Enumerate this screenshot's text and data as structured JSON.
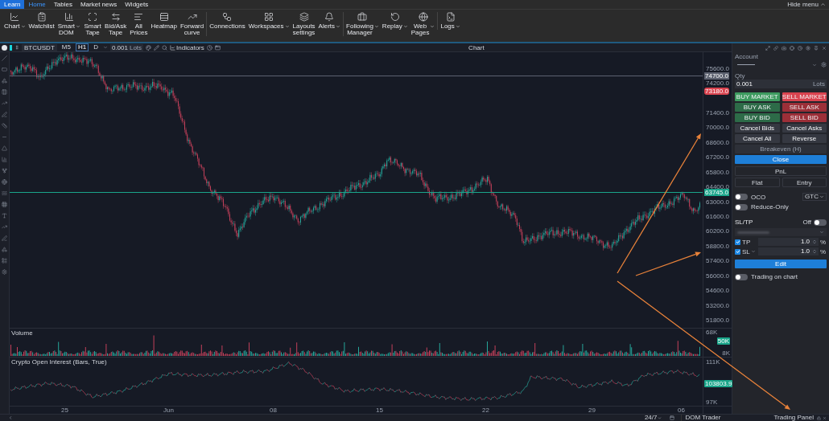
{
  "menu_bar": {
    "learn_button": "Learn",
    "tabs": [
      {
        "label": "Home",
        "selected": true
      },
      {
        "label": "Tables",
        "selected": false
      },
      {
        "label": "Market news",
        "selected": false
      },
      {
        "label": "Widgets",
        "selected": false
      }
    ],
    "hide_menu": "Hide menu"
  },
  "ribbon": [
    [
      {
        "label": "Chart",
        "has_menu": true
      },
      {
        "label": "Watchlist",
        "has_menu": false
      },
      {
        "label": "Smart DOM",
        "has_menu": true
      },
      {
        "label": "Smart Tape",
        "has_menu": false
      },
      {
        "label": "Bid/Ask Tape",
        "has_menu": false
      },
      {
        "label": "All Prices",
        "has_menu": false
      },
      {
        "label": "Heatmap",
        "has_menu": false
      },
      {
        "label": "Forward curve",
        "has_menu": false
      }
    ],
    [
      {
        "label": "Connections",
        "has_menu": false
      },
      {
        "label": "Workspaces",
        "has_menu": true
      },
      {
        "label": "Layouts settings",
        "has_menu": false
      },
      {
        "label": "Alerts",
        "has_menu": true
      }
    ],
    [
      {
        "label": "Following Manager",
        "has_menu": true
      },
      {
        "label": "Replay",
        "has_menu": true
      },
      {
        "label": "Web Pages",
        "has_menu": true
      }
    ],
    [
      {
        "label": "Logs",
        "has_menu": true
      }
    ]
  ],
  "chart": {
    "title": "Chart",
    "symbol": "BTCUSDT",
    "timeframes": [
      {
        "label": "M5",
        "selected": false
      },
      {
        "label": "H1",
        "selected": true
      },
      {
        "label": "D",
        "selected": false
      }
    ],
    "quantity": "0.001",
    "quantity_unit": "Lots",
    "indicators": "Indicators",
    "price_ticks": [
      "75600.0",
      "74200.0",
      "71400.0",
      "70000.0",
      "68600.0",
      "67200.0",
      "65800.0",
      "64400.0",
      "63000.0",
      "61600.0",
      "60200.0",
      "58800.0",
      "57400.0",
      "56000.0",
      "54600.0",
      "53200.0",
      "51800.0"
    ],
    "price_markers": [
      {
        "label": "74700.0",
        "color": "#5d6270",
        "line": true
      },
      {
        "label": "73180.0",
        "color": "#d9434f",
        "line": false
      },
      {
        "label": "63745.0",
        "color": "#1aa58a",
        "line": true
      }
    ],
    "volume": {
      "title": "Volume",
      "ticks": [
        "68K",
        "8K"
      ],
      "marker": {
        "label": "50K",
        "color": "#1aa58a"
      }
    },
    "open_interest": {
      "title": "Crypto Open Interest (Bars, True)",
      "ticks": [
        "111K",
        "97K"
      ],
      "marker": {
        "label": "103803.9",
        "color": "#1aa58a"
      }
    },
    "dates": [
      "25",
      "Jun",
      "08",
      "15",
      "22",
      "29",
      "06"
    ]
  },
  "trading_panel": {
    "account_label": "Account",
    "qty_label": "Qty",
    "qty": "0.001",
    "qty_unit": "Lots",
    "order_buttons": [
      {
        "label": "BUY MARKET",
        "kind": "buy",
        "strong": true
      },
      {
        "label": "SELL MARKET",
        "kind": "sell",
        "strong": true
      },
      {
        "label": "BUY ASK",
        "kind": "buy",
        "strong": false
      },
      {
        "label": "SELL ASK",
        "kind": "sell",
        "strong": false
      },
      {
        "label": "BUY BID",
        "kind": "buy",
        "strong": false
      },
      {
        "label": "SELL BID",
        "kind": "sell",
        "strong": false
      },
      {
        "label": "Cancel Bids",
        "kind": "neutral",
        "strong": false
      },
      {
        "label": "Cancel Asks",
        "kind": "neutral",
        "strong": false
      },
      {
        "label": "Cancel All",
        "kind": "neutral",
        "strong": false
      },
      {
        "label": "Reverse",
        "kind": "neutral",
        "strong": false
      }
    ],
    "breakeven": {
      "label": "Breakeven (H)",
      "disabled": true
    },
    "close_button": "Close",
    "pnl": "PnL",
    "flat": "Flat",
    "entry": "Entry",
    "oco": {
      "label": "OCO",
      "on": false
    },
    "time_in_force": "GTC",
    "reduce_only": {
      "label": "Reduce-Only",
      "on": false
    },
    "sl_tp": {
      "title": "SL/TP",
      "status": "Off",
      "on": false,
      "rows": [
        {
          "label": "TP",
          "checked": true,
          "value": "1.0",
          "unit": "%",
          "has_menu": false
        },
        {
          "label": "SL",
          "checked": true,
          "value": "1.0",
          "unit": "%",
          "has_menu": true
        }
      ]
    },
    "edit_button": "Edit",
    "trading_on_chart": {
      "label": "Trading on chart",
      "on": false
    }
  },
  "bottom_bar": {
    "session": "24/7",
    "dom_trader": "DOM Trader",
    "trading_panel": "Trading Panel"
  }
}
